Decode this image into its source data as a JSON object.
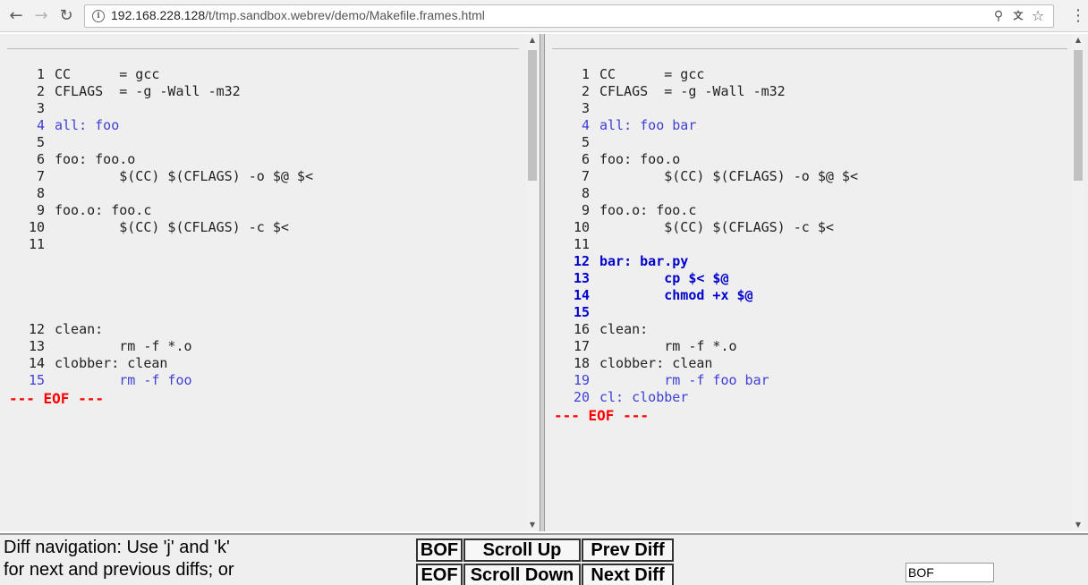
{
  "browser": {
    "url_host": "192.168.228.128",
    "url_path": "/t/tmp.sandbox.webrev/demo/Makefile.frames.html"
  },
  "left_pane": {
    "lines": [
      {
        "num": "1",
        "text": "CC      = gcc",
        "style": "normal"
      },
      {
        "num": "2",
        "text": "CFLAGS  = -g -Wall -m32",
        "style": "normal"
      },
      {
        "num": "3",
        "text": "",
        "style": "normal"
      },
      {
        "num": "4",
        "text": "all: foo",
        "style": "changed"
      },
      {
        "num": "5",
        "text": "",
        "style": "normal"
      },
      {
        "num": "6",
        "text": "foo: foo.o",
        "style": "normal"
      },
      {
        "num": "7",
        "text": "        $(CC) $(CFLAGS) -o $@ $<",
        "style": "normal"
      },
      {
        "num": "8",
        "text": "",
        "style": "normal"
      },
      {
        "num": "9",
        "text": "foo.o: foo.c",
        "style": "normal"
      },
      {
        "num": "10",
        "text": "        $(CC) $(CFLAGS) -c $<",
        "style": "normal"
      },
      {
        "num": "11",
        "text": "",
        "style": "normal"
      },
      {
        "num": "",
        "text": "",
        "style": "pad"
      },
      {
        "num": "",
        "text": "",
        "style": "pad"
      },
      {
        "num": "",
        "text": "",
        "style": "pad"
      },
      {
        "num": "",
        "text": "",
        "style": "pad"
      },
      {
        "num": "12",
        "text": "clean:",
        "style": "normal"
      },
      {
        "num": "13",
        "text": "        rm -f *.o",
        "style": "normal"
      },
      {
        "num": "14",
        "text": "clobber: clean",
        "style": "normal"
      },
      {
        "num": "15",
        "text": "        rm -f foo",
        "style": "changed"
      }
    ],
    "eof": "--- EOF ---"
  },
  "right_pane": {
    "lines": [
      {
        "num": "1",
        "text": "CC      = gcc",
        "style": "normal"
      },
      {
        "num": "2",
        "text": "CFLAGS  = -g -Wall -m32",
        "style": "normal"
      },
      {
        "num": "3",
        "text": "",
        "style": "normal"
      },
      {
        "num": "4",
        "text": "all: foo bar",
        "style": "changed"
      },
      {
        "num": "5",
        "text": "",
        "style": "normal"
      },
      {
        "num": "6",
        "text": "foo: foo.o",
        "style": "normal"
      },
      {
        "num": "7",
        "text": "        $(CC) $(CFLAGS) -o $@ $<",
        "style": "normal"
      },
      {
        "num": "8",
        "text": "",
        "style": "normal"
      },
      {
        "num": "9",
        "text": "foo.o: foo.c",
        "style": "normal"
      },
      {
        "num": "10",
        "text": "        $(CC) $(CFLAGS) -c $<",
        "style": "normal"
      },
      {
        "num": "11",
        "text": "",
        "style": "normal"
      },
      {
        "num": "12",
        "text": "bar: bar.py",
        "style": "added"
      },
      {
        "num": "13",
        "text": "        cp $< $@",
        "style": "added"
      },
      {
        "num": "14",
        "text": "        chmod +x $@",
        "style": "added"
      },
      {
        "num": "15",
        "text": "",
        "style": "added"
      },
      {
        "num": "16",
        "text": "clean:",
        "style": "normal"
      },
      {
        "num": "17",
        "text": "        rm -f *.o",
        "style": "normal"
      },
      {
        "num": "18",
        "text": "clobber: clean",
        "style": "normal"
      },
      {
        "num": "19",
        "text": "        rm -f foo bar",
        "style": "changed"
      },
      {
        "num": "20",
        "text": "cl: clobber",
        "style": "changed"
      }
    ],
    "eof": "--- EOF ---"
  },
  "navigation": {
    "help_line1": "Diff navigation: Use 'j' and 'k'",
    "help_line2": "for next and previous diffs; or",
    "bof_label": "BOF",
    "scroll_up_label": "Scroll Up",
    "prev_diff_label": "Prev Diff",
    "eof_label": "EOF",
    "scroll_down_label": "Scroll Down",
    "next_diff_label": "Next Diff",
    "position_value": "BOF"
  },
  "colors": {
    "changed": "#3f3fd6",
    "added": "#0000cc",
    "eof": "#ff0000",
    "pane_bg": "#efefef"
  }
}
